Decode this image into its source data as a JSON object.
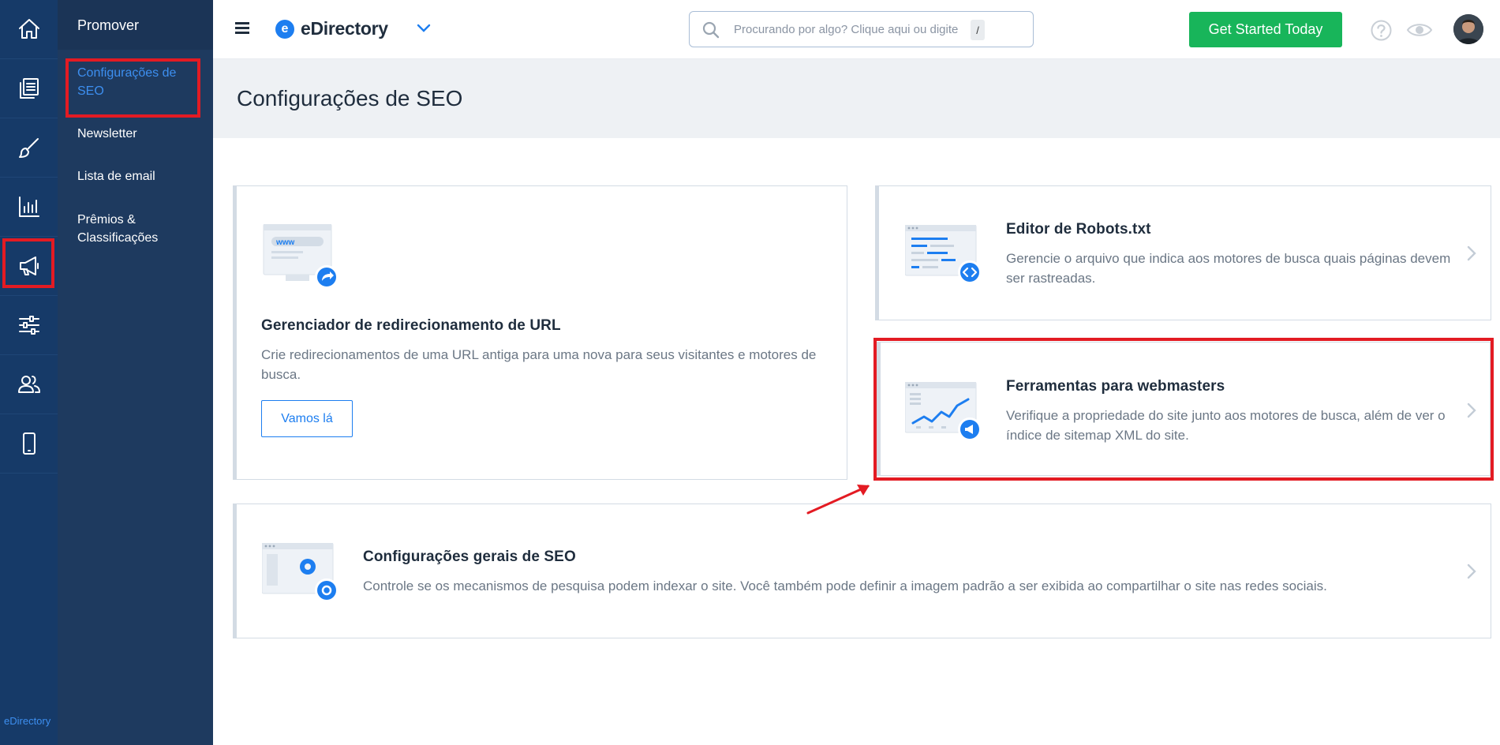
{
  "rail": {
    "items": [
      {
        "icon": "home-icon"
      },
      {
        "icon": "content-icon"
      },
      {
        "icon": "brush-icon"
      },
      {
        "icon": "chart-icon"
      },
      {
        "icon": "megaphone-icon"
      },
      {
        "icon": "sliders-icon"
      },
      {
        "icon": "users-icon"
      },
      {
        "icon": "mobile-icon"
      }
    ],
    "brand": "eDirectory"
  },
  "submenu": {
    "title": "Promover",
    "items": [
      {
        "label": "Configurações de SEO",
        "active": true
      },
      {
        "label": "Newsletter"
      },
      {
        "label": "Lista de email"
      },
      {
        "label": "Prêmios & Classificações"
      }
    ]
  },
  "topbar": {
    "logo_text": "eDirectory",
    "logo_mark": "e",
    "search_placeholder": "Procurando por algo? Clique aqui ou digite",
    "search_shortcut": "/",
    "cta_label": "Get Started Today"
  },
  "page": {
    "title": "Configurações de SEO"
  },
  "cards": {
    "redirect": {
      "title": "Gerenciador de redirecionamento de URL",
      "description": "Crie redirecionamentos de uma URL antiga para uma nova para seus visitantes e motores de busca.",
      "button": "Vamos lá",
      "www": "www"
    },
    "robots": {
      "title": "Editor de Robots.txt",
      "description": "Gerencie o arquivo que indica aos motores de busca quais páginas devem ser rastreadas."
    },
    "webmasters": {
      "title": "Ferramentas para webmasters",
      "description": "Verifique a propriedade do site junto aos motores de busca, além de ver o índice de sitemap XML do site."
    },
    "general": {
      "title": "Configurações gerais de SEO",
      "description": "Controle se os mecanismos de pesquisa podem indexar o site. Você também pode definir a imagem padrão a ser exibida ao compartilhar o site nas redes sociais."
    }
  },
  "colors": {
    "rail_bg": "#163a68",
    "submenu_bg": "#1e3a5f",
    "accent": "#1d7ef0",
    "cta": "#18b55a",
    "annotation": "#e31b23"
  }
}
